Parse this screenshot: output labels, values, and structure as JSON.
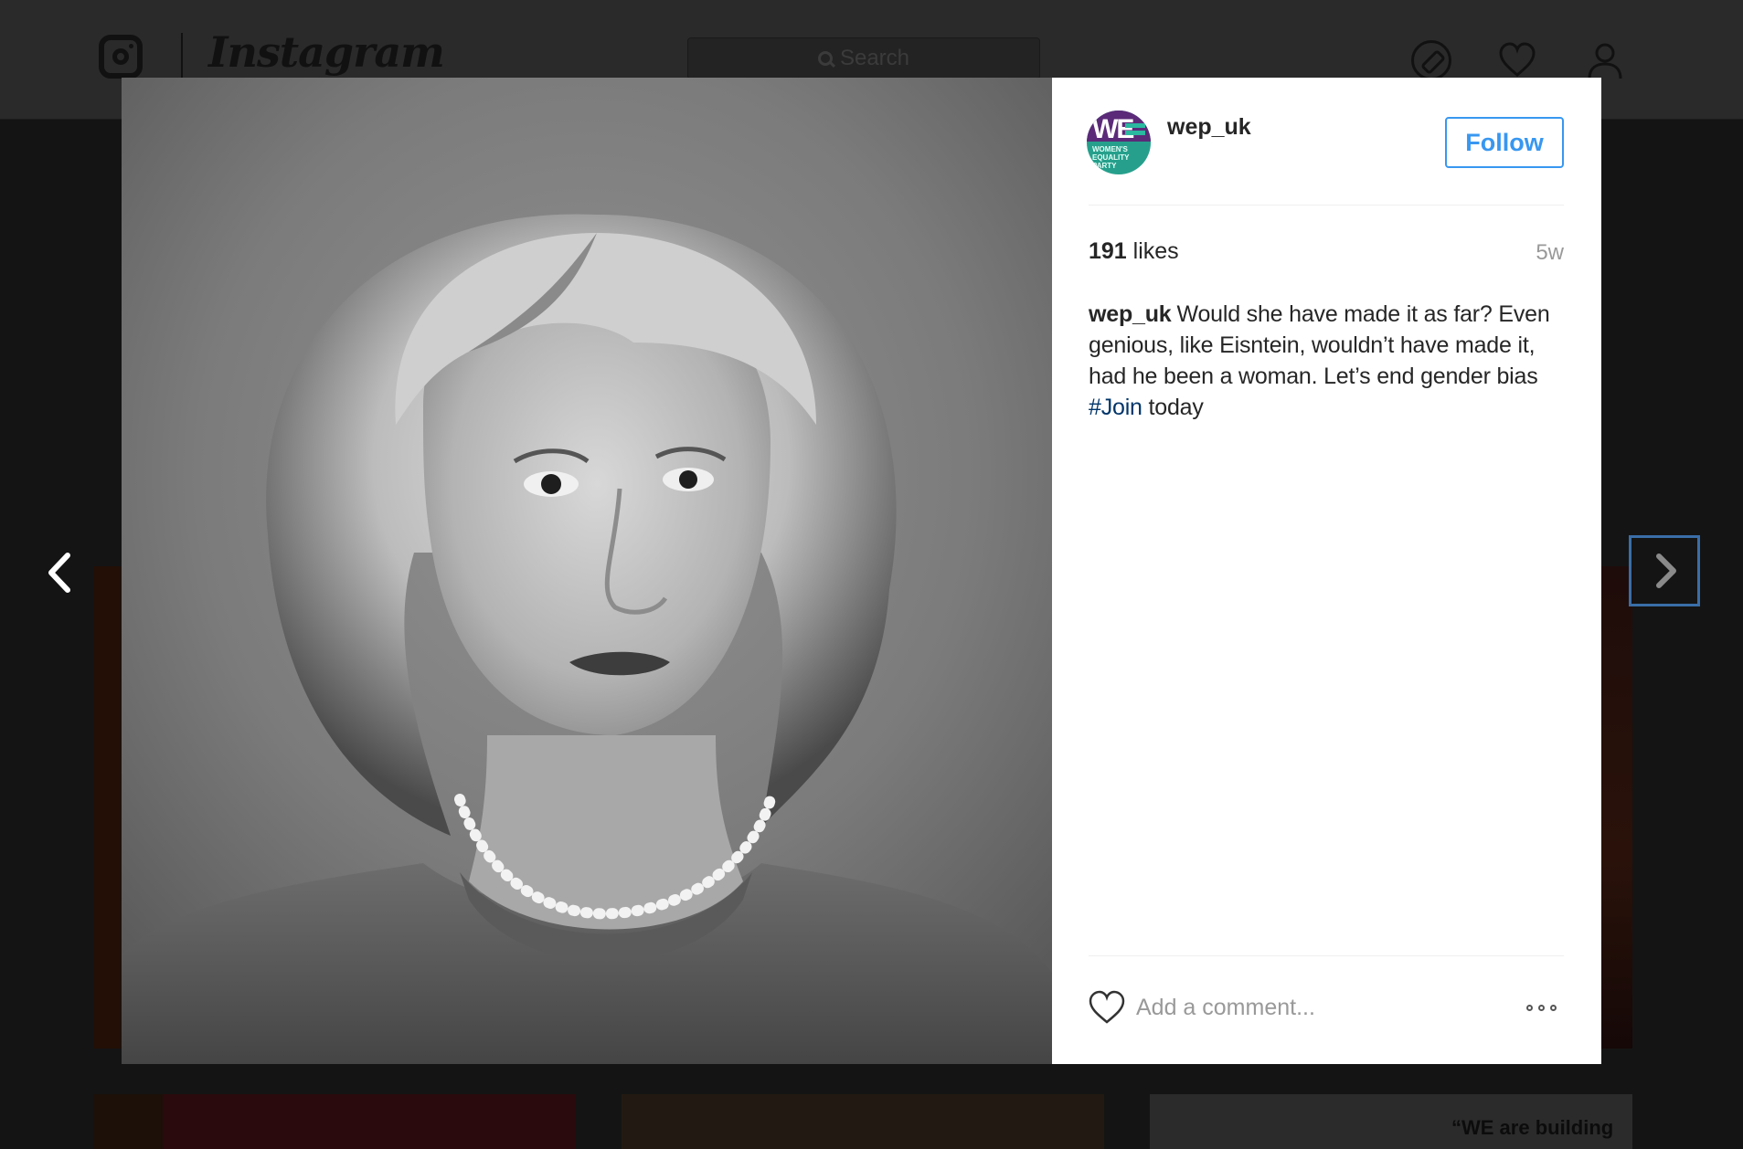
{
  "app": {
    "wordmark": "Instagram",
    "search_placeholder": "Search"
  },
  "background": {
    "tile_caption": "“WE are building"
  },
  "post": {
    "author": "wep_uk",
    "avatar_label_line1": "WOMEN'S",
    "avatar_label_line2": "EQUALITY",
    "avatar_label_line3": "PARTY",
    "avatar_monogram": "WE",
    "follow_label": "Follow",
    "likes_count": "191",
    "likes_label": "likes",
    "time_ago": "5w",
    "caption_user": "wep_uk",
    "caption_text": "Would she have made it as far? Even genious, like Eisntein, wouldn’t have made it, had he been a woman. Let’s end gender bias ",
    "caption_hashtag": "#Join",
    "caption_tail": " today",
    "comment_placeholder": "Add a comment...",
    "photo_description_icon": "portrait-photo"
  },
  "colors": {
    "accent_blue": "#3897f0",
    "hashtag_blue": "#003569",
    "brand_purple": "#5b2a78",
    "brand_teal": "#26a08c"
  }
}
